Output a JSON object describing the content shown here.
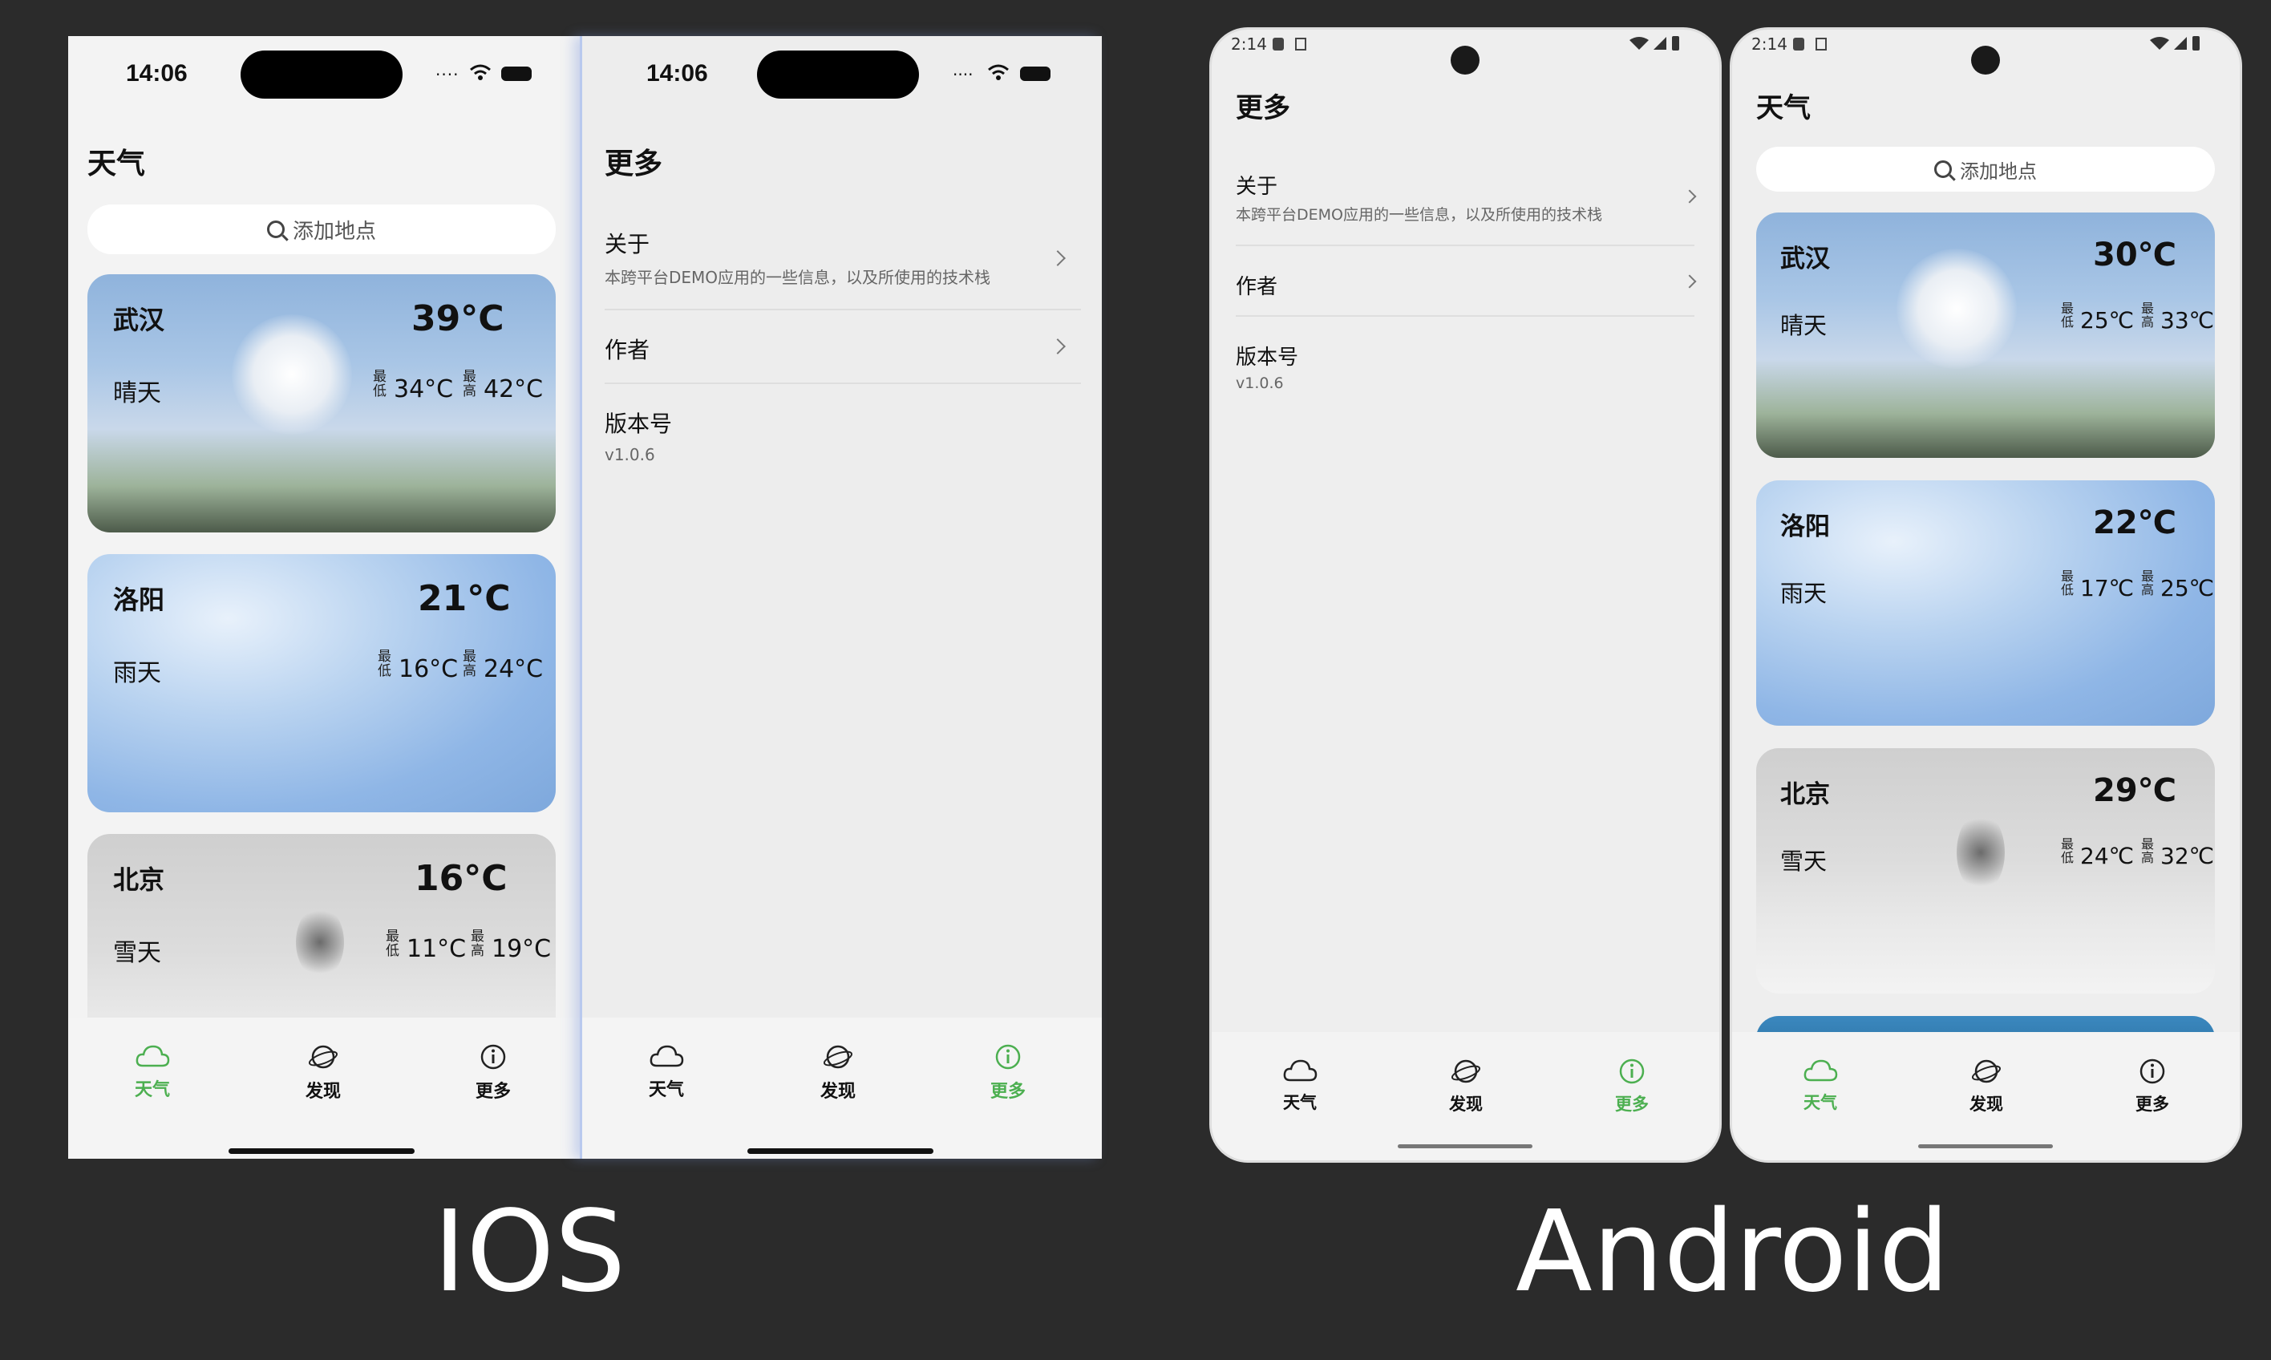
{
  "captions": {
    "ios": "IOS",
    "android": "Android"
  },
  "ios_weather": {
    "status_time": "14:06",
    "title": "天气",
    "search_placeholder": "添加地点",
    "cards": [
      {
        "city": "武汉",
        "temp": "39°C",
        "weather": "晴天",
        "min_label": "最低",
        "min": "34°C",
        "max_label": "最高",
        "max": "42°C"
      },
      {
        "city": "洛阳",
        "temp": "21°C",
        "weather": "雨天",
        "min_label": "最低",
        "min": "16°C",
        "max_label": "最高",
        "max": "24°C"
      },
      {
        "city": "北京",
        "temp": "16°C",
        "weather": "雪天",
        "min_label": "最低",
        "min": "11°C",
        "max_label": "最高",
        "max": "19°C"
      }
    ],
    "tabs": [
      "天气",
      "发现",
      "更多"
    ],
    "active_tab": 0
  },
  "ios_more": {
    "status_time": "14:06",
    "title": "更多",
    "items": [
      {
        "label": "关于",
        "sub": "本跨平台DEMO应用的一些信息，以及所使用的技术栈"
      },
      {
        "label": "作者",
        "sub": ""
      },
      {
        "label": "版本号",
        "sub": "v1.0.6"
      }
    ],
    "tabs": [
      "天气",
      "发现",
      "更多"
    ],
    "active_tab": 2
  },
  "android_more": {
    "status_time": "2:14",
    "title": "更多",
    "items": [
      {
        "label": "关于",
        "sub": "本跨平台DEMO应用的一些信息，以及所使用的技术栈"
      },
      {
        "label": "作者",
        "sub": ""
      },
      {
        "label": "版本号",
        "sub": "v1.0.6"
      }
    ],
    "tabs": [
      "天气",
      "发现",
      "更多"
    ],
    "active_tab": 2
  },
  "android_weather": {
    "status_time": "2:14",
    "title": "天气",
    "search_placeholder": "添加地点",
    "cards": [
      {
        "city": "武汉",
        "temp": "30℃",
        "weather": "晴天",
        "min_label": "最低",
        "min": "25℃",
        "max_label": "最高",
        "max": "33℃"
      },
      {
        "city": "洛阳",
        "temp": "22℃",
        "weather": "雨天",
        "min_label": "最低",
        "min": "17℃",
        "max_label": "最高",
        "max": "25℃"
      },
      {
        "city": "北京",
        "temp": "29℃",
        "weather": "雪天",
        "min_label": "最低",
        "min": "24℃",
        "max_label": "最高",
        "max": "32℃"
      }
    ],
    "tabs": [
      "天气",
      "发现",
      "更多"
    ],
    "active_tab": 0
  },
  "colors": {
    "accent": "#4caf50",
    "background": "#2b2b2b",
    "screen": "#eeeeee"
  },
  "icons": {
    "weather_tab": "cloud-icon",
    "discover_tab": "planet-icon",
    "more_tab": "info-icon",
    "search": "search-icon"
  }
}
